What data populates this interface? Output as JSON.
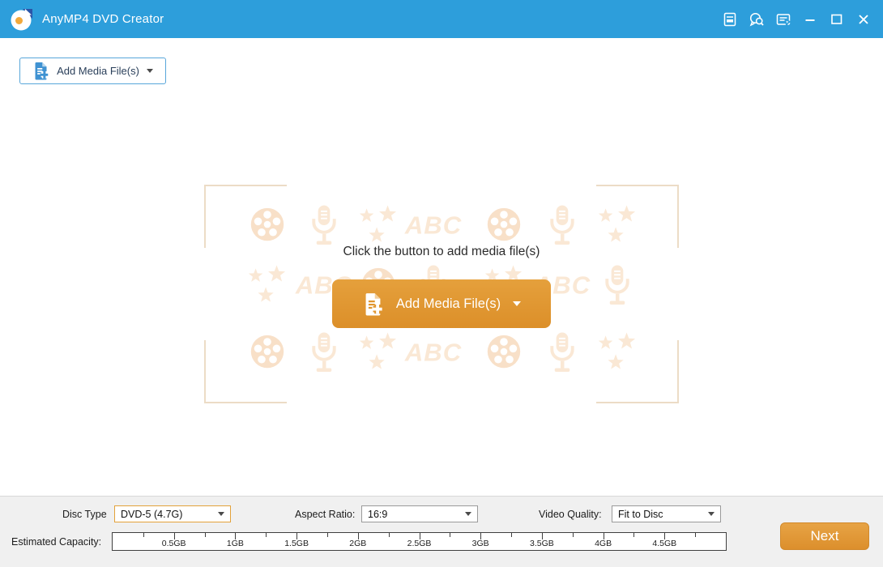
{
  "titlebar": {
    "title": "AnyMP4 DVD Creator",
    "action_icons": [
      "register-document-icon",
      "support-chat-icon",
      "feedback-menu-icon"
    ],
    "window_controls": [
      "minimize",
      "maximize",
      "close"
    ],
    "color": "#2D9EDB"
  },
  "toolbar": {
    "add_media_label": "Add Media File(s)"
  },
  "main": {
    "message": "Click the button to add media file(s)",
    "add_media_label": "Add Media File(s)",
    "button_color": "#E0962F"
  },
  "watermark": {
    "color": "#FAE8D5",
    "film_color": "#F8E0C8",
    "rows": [
      [
        "film",
        "mic",
        "stars",
        "abc",
        "film",
        "mic",
        "stars"
      ],
      [
        "stars",
        "abc",
        "film",
        "mic",
        "stars",
        "abc",
        "mic"
      ],
      [
        "film",
        "mic",
        "stars",
        "abc",
        "film",
        "mic",
        "stars"
      ]
    ]
  },
  "footer": {
    "disc_type_label": "Disc Type",
    "disc_type_value": "DVD-5 (4.7G)",
    "aspect_ratio_label": "Aspect Ratio:",
    "aspect_ratio_value": "16:9",
    "video_quality_label": "Video Quality:",
    "video_quality_value": "Fit to Disc",
    "estimated_capacity_label": "Estimated Capacity:",
    "capacity": {
      "max_gb": 5,
      "tick_step_gb": 0.25,
      "labels": [
        "0.5GB",
        "1GB",
        "1.5GB",
        "2GB",
        "2.5GB",
        "3GB",
        "3.5GB",
        "4GB",
        "4.5GB"
      ]
    },
    "next_label": "Next"
  }
}
